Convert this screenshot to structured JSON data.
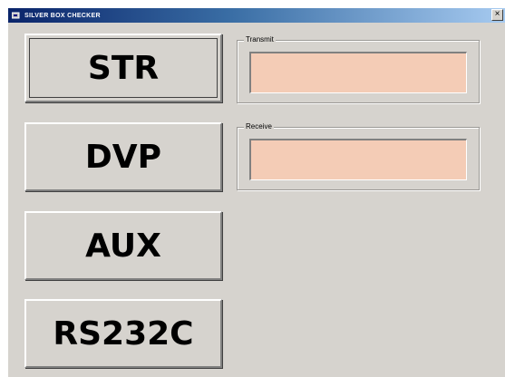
{
  "window": {
    "title": "SILVER BOX CHECKER",
    "close_glyph": "×"
  },
  "buttons": [
    {
      "id": "str",
      "label": "STR"
    },
    {
      "id": "dvp",
      "label": "DVP"
    },
    {
      "id": "aux",
      "label": "AUX"
    },
    {
      "id": "rs232c",
      "label": "RS232C"
    }
  ],
  "transmit": {
    "label": "Transmit",
    "value": ""
  },
  "receive": {
    "label": "Receive",
    "value": ""
  },
  "colors": {
    "field_background": "#f4ccb6",
    "window_background": "#d6d3ce",
    "titlebar": "#0a246a"
  }
}
